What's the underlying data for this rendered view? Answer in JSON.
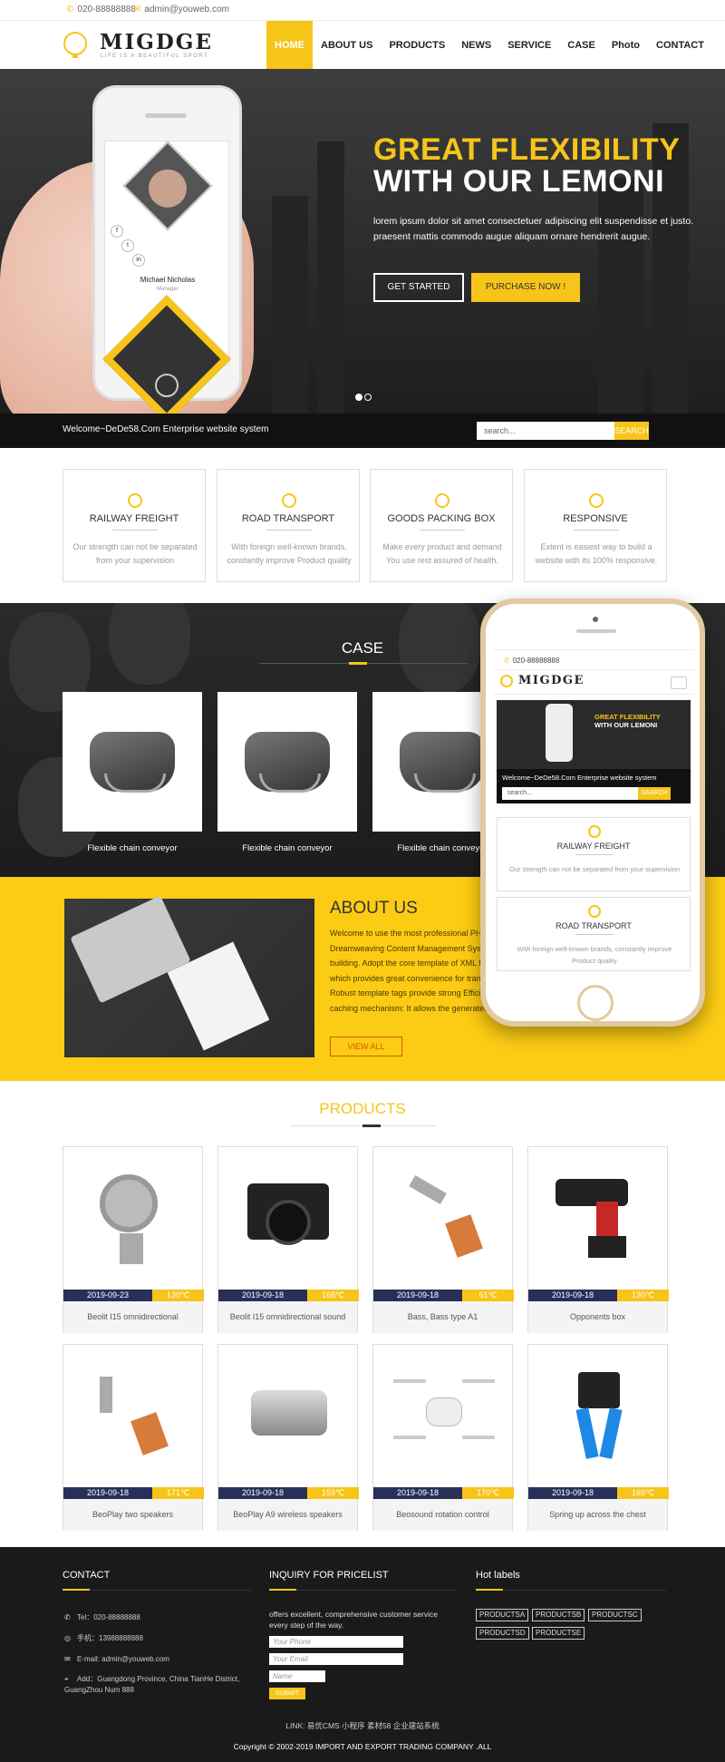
{
  "topbar": {
    "phone": "020-88888888",
    "email": "admin@youweb.com"
  },
  "logo": {
    "name": "MIGDGE",
    "slogan": "LIFE IS A BEAUTIFUL SPORT"
  },
  "nav": [
    "HOME",
    "ABOUT US",
    "PRODUCTS",
    "NEWS",
    "SERVICE",
    "CASE",
    "Photo",
    "CONTACT"
  ],
  "hero": {
    "title1": "GREAT FLEXIBILITY",
    "title2": "WITH OUR LEMONI",
    "text": "lorem ipsum dolor sit amet consectetuer adipiscing elit suspendisse et justo. praesent mattis commodo augue aliquam ornare hendrerit augue.",
    "btn_start": "GET STARTED",
    "btn_buy": "PURCHASE NOW !",
    "phone_person_name": "Michael Nicholas",
    "phone_person_role": "Manager"
  },
  "strip": {
    "welcome": "Welcome~DeDe58.Com Enterprise website system",
    "search_placeholder": "search...",
    "search_btn": "SEARCH"
  },
  "features": [
    {
      "title": "RAILWAY FREIGHT",
      "desc": "Our strength can not be separated from your supervision",
      "icon": "clock-icon"
    },
    {
      "title": "ROAD TRANSPORT",
      "desc": "With foreign well-known brands, constantly improve Product quality",
      "icon": "gear-icon"
    },
    {
      "title": "GOODS PACKING BOX",
      "desc": "Make every product and demand You use rest assured of health.",
      "icon": "umbrella-icon"
    },
    {
      "title": "RESPONSIVE",
      "desc": "Extent is easiest way to build a website with its 100% responsive.",
      "icon": "user-icon"
    }
  ],
  "case": {
    "title": "CASE",
    "items": [
      "Flexible chain conveyor",
      "Flexible chain conveyor",
      "Flexible chain conveyor"
    ]
  },
  "about": {
    "title": "ABOUT US",
    "text": "Welcome to use the most professional PHP Dreamweaving Content Management System building. Adopt the core template of XML form, which provides great convenience for transfer. Robust template tags provide strong Efficient tag caching mechanism: It allows the generated, it is helpful to improve the response speed.",
    "btn": "VIEW ALL"
  },
  "mobile": {
    "phone": "020-88888888",
    "logo": "MIGDGE",
    "hero_t1": "GREAT FLEXIBILITY",
    "hero_t2": "WITH OUR LEMONI",
    "welcome": "Welcome~DeDe58.Com Enterprise website system",
    "search": "search...",
    "search_btn": "SEARCH",
    "cards": [
      {
        "title": "RAILWAY FREIGHT",
        "desc": "Our strength can not be separated from your supervision"
      },
      {
        "title": "ROAD TRANSPORT",
        "desc": "With foreign well-known brands, constantly improve Product quality"
      }
    ]
  },
  "products": {
    "title": "PRODUCTS",
    "items": [
      {
        "date": "2019-09-23",
        "temp": "130℃",
        "name": "Beolit I15 omnidirectional"
      },
      {
        "date": "2019-09-18",
        "temp": "168℃",
        "name": "Beolit I15 omnidirectional sound"
      },
      {
        "date": "2019-09-18",
        "temp": "61℃",
        "name": "Bass, Bass type A1"
      },
      {
        "date": "2019-09-18",
        "temp": "130℃",
        "name": "Opponents box"
      },
      {
        "date": "2019-09-18",
        "temp": "171℃",
        "name": "BeoPlay two speakers"
      },
      {
        "date": "2019-09-18",
        "temp": "159℃",
        "name": "BeoPlay A9 wireless speakers"
      },
      {
        "date": "2019-09-18",
        "temp": "170℃",
        "name": "Beosound rotation control"
      },
      {
        "date": "2019-09-18",
        "temp": "169℃",
        "name": "Spring up across the chest"
      }
    ]
  },
  "footer": {
    "contact_title": "CONTACT",
    "tel": "Tel：020-88888888",
    "mobile": "手机：13988888888",
    "email": "E-mail: admin@youweb.com",
    "address": "Add：Guangdong Province, China TianHe District, GuangZhou Num 888",
    "inquiry_title": "INQUIRY FOR PRICELIST",
    "inquiry_text": "offers excellent, comprehensive customer service every step of the way.",
    "phone_ph": "Your Phone",
    "email_ph": "Your Email",
    "name_ph": "Name",
    "submit": "SUBMIT",
    "labels_title": "Hot labels",
    "tags": [
      "PRODUCTSA",
      "PRODUCTSB",
      "PRODUCTSC",
      "PRODUCTSD",
      "PRODUCTSE"
    ],
    "links": "LINK: 易优CMS 小程序 素材58 企业建站系统",
    "copyright": "Copyright © 2002-2019 IMPORT AND EXPORT TRADING COMPANY .ALL"
  },
  "colors": {
    "accent": "#f7c51a",
    "dark": "#111111",
    "navy": "#28305a"
  }
}
